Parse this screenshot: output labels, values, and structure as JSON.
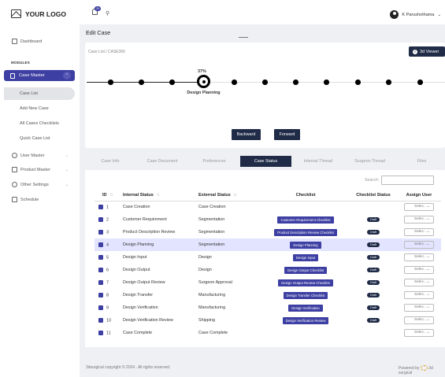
{
  "logo": "YOUR LOGO",
  "notification_count": "20",
  "user_name": "K Parushothama",
  "sidebar": {
    "dashboard": "Dashboard",
    "modules": "MODULES",
    "case_master": "Case Master",
    "sub_items": [
      "Case List",
      "Add New Case",
      "All Cases Checklists",
      "Quick Case List"
    ],
    "user_master": "User Master",
    "product_master": "Product Master",
    "other_settings": "Other Settings",
    "schedule": "Schedule"
  },
  "page_title": "Edit Case",
  "breadcrumb": "Case List /  CASE366",
  "viewer_button": "3d Viewer",
  "progress": {
    "percent_label": "37%",
    "stage": "Design Planning",
    "fraction": 0.37
  },
  "buttons": {
    "backward": "Backward",
    "forward": "Forward"
  },
  "tabs": [
    "Case Info",
    "Case Document",
    "Preferences",
    "Case Status",
    "Internal Thread",
    "Surgeon Thread",
    "Files"
  ],
  "active_tab": "Case Status",
  "search_label": "Search:",
  "table": {
    "headers": [
      "ID",
      "Internal Status",
      "External Status",
      "Checklist",
      "Checklist Status",
      "Assign User"
    ],
    "rows": [
      {
        "id": "1",
        "internal": "Case Creation",
        "external": "Case Creation",
        "checklist": "",
        "status": "",
        "assign": "Selec..."
      },
      {
        "id": "2",
        "internal": "Customer Requirement",
        "external": "Segmentation",
        "checklist": "Customer Requirement Checklist",
        "status": "Draft",
        "assign": "Selec..."
      },
      {
        "id": "3",
        "internal": "Product Description Review",
        "external": "Segmentation",
        "checklist": "Product Description Review Checklist",
        "status": "Draft",
        "assign": "Selec..."
      },
      {
        "id": "4",
        "internal": "Design Planning",
        "external": "Segmentation",
        "checklist": "Design Planning",
        "status": "Draft",
        "assign": "Selec..."
      },
      {
        "id": "5",
        "internal": "Design Input",
        "external": "Design",
        "checklist": "Design Input",
        "status": "Draft",
        "assign": "Selec..."
      },
      {
        "id": "6",
        "internal": "Design Output",
        "external": "Design",
        "checklist": "Design Output Checklist",
        "status": "Draft",
        "assign": "Selec..."
      },
      {
        "id": "7",
        "internal": "Design Output Review",
        "external": "Surgeon Approval",
        "checklist": "Design Output Review Checklist",
        "status": "Draft",
        "assign": "Selec..."
      },
      {
        "id": "8",
        "internal": "Design Transfer",
        "external": "Manufacturing",
        "checklist": "Design Transfer Checklist",
        "status": "Draft",
        "assign": "Selec..."
      },
      {
        "id": "9",
        "internal": "Design Verification",
        "external": "Manufacturing",
        "checklist": "Design Verification",
        "status": "Draft",
        "assign": "Selec..."
      },
      {
        "id": "10",
        "internal": "Design Verification Review",
        "external": "Shipping",
        "checklist": "Design Verification Review",
        "status": "Draft",
        "assign": "Selec..."
      },
      {
        "id": "11",
        "internal": "Case Complete",
        "external": "Case Complete",
        "checklist": "",
        "status": "",
        "assign": "Selec..."
      }
    ],
    "highlighted_row": "4"
  },
  "footer": {
    "copyright": "3dsurgical copyright © 2024 . All rights reserved.",
    "powered_by": "Powered by",
    "brand": "3d surgical"
  },
  "colors": {
    "primary": "#3d3fa2",
    "dark": "#1f2b47",
    "highlight": "#e3e4ff"
  }
}
